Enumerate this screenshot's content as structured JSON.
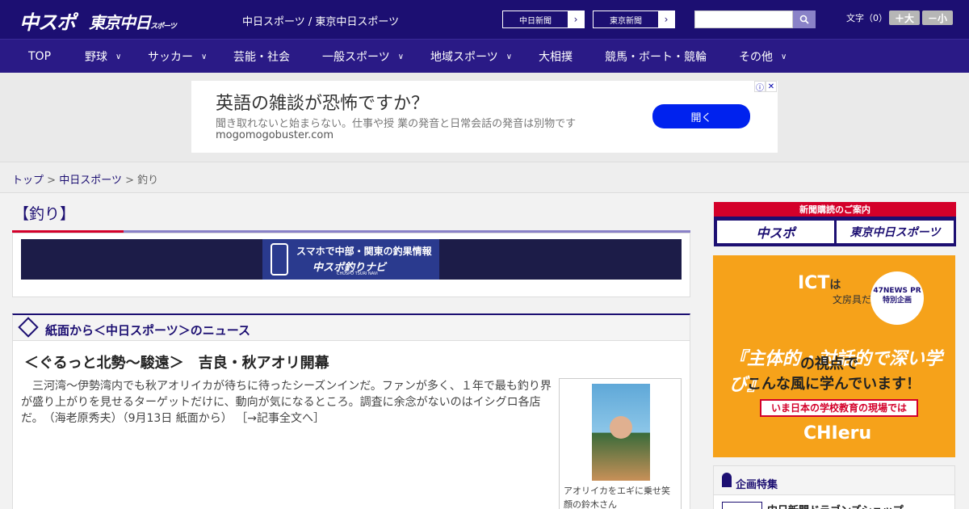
{
  "header": {
    "logo_main": "中スポ",
    "logo_tokyo": "東京中日",
    "logo_tokyo_small": "スポーツ",
    "site_title": "中日スポーツ / 東京中日スポーツ",
    "paper_links": [
      "中日新聞",
      "東京新聞"
    ],
    "fontsize_label": "文字（0）",
    "fontsize_buttons": [
      "＋大",
      "－小"
    ]
  },
  "nav": {
    "items": [
      {
        "label": "TOP",
        "dropdown": false
      },
      {
        "label": "野球",
        "dropdown": true
      },
      {
        "label": "サッカー",
        "dropdown": true
      },
      {
        "label": "芸能・社会",
        "dropdown": false
      },
      {
        "label": "一般スポーツ",
        "dropdown": true
      },
      {
        "label": "地域スポーツ",
        "dropdown": true
      },
      {
        "label": "大相撲",
        "dropdown": false
      },
      {
        "label": "競馬・ボート・競輪",
        "dropdown": false
      },
      {
        "label": "その他",
        "dropdown": true
      }
    ]
  },
  "ad": {
    "headline": "英語の雑談が恐怖ですか？",
    "description": "聞き取れないと始まらない。仕事や授 業の発音と日常会話の発音は別物です",
    "domain": "mogomogobuster.com",
    "button": "開く"
  },
  "breadcrumb": {
    "items": [
      "トップ",
      "中日スポーツ"
    ],
    "current": "釣り",
    "separator": ">"
  },
  "category": {
    "title": "【釣り】"
  },
  "banner": {
    "line1": "スマホで中部・関東の釣果情報",
    "line2": "中スポ釣りナビ",
    "line3": "CHUSPO TSURI NAVI"
  },
  "news": {
    "section_title": "紙面から＜中日スポーツ＞のニュース",
    "article_title": "＜ぐるっと北勢～駿遠＞　吉良・秋アオリ開幕",
    "article_body": "　三河湾～伊勢湾内でも秋アオリイカが待ちに待ったシーズンインだ。ファンが多く、１年で最も釣り界が盛り上がりを見せるターゲットだけに、動向が気になるところ。調査に余念がないのはイシグロ各店だ。　（海老原秀夫）（9月13日 紙面から）",
    "more_link": "［→記事全文へ］",
    "photo_caption": "アオリイカをエギに乗せ笑顔の鈴木さん"
  },
  "sidebar": {
    "subscribe_title": "新聞購読のご案内",
    "subscribe_buttons": [
      "中スポ",
      "東京中日スポーツ"
    ],
    "pr": {
      "ict_big": "ICT",
      "ict_small": "は",
      "ict_line2": "文房具だ！",
      "badge": "47NEWS PR 特別企画",
      "big": "『主体的・対話的で深い学び』",
      "line2": "の視点で",
      "line3": "こんな風に学んでいます！",
      "ribbon": "いま日本の学校教育の現場では",
      "brand": "CHIeru"
    },
    "feature_title": "企画特集",
    "feature_item": "中日新聞ドラゴンズショップ"
  }
}
